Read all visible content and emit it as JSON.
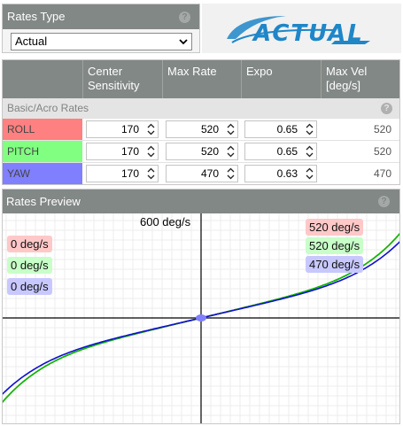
{
  "rates_type": {
    "title": "Rates Type",
    "help_glyph": "?",
    "selected": "Actual",
    "options": [
      "Actual"
    ]
  },
  "logo": {
    "text": "ACTUAL",
    "color": "#1f86c8"
  },
  "table": {
    "headers": [
      "",
      "Center Sensitivity",
      "Max Rate",
      "Expo",
      "Max Vel [deg/s]"
    ],
    "section_label": "Basic/Acro Rates",
    "help_glyph": "?",
    "rows": [
      {
        "axis": "ROLL",
        "color": "#ff8080",
        "center": "170",
        "max_rate": "520",
        "expo": "0.65",
        "max_vel": "520"
      },
      {
        "axis": "PITCH",
        "color": "#80ff80",
        "center": "170",
        "max_rate": "520",
        "expo": "0.65",
        "max_vel": "520"
      },
      {
        "axis": "YAW",
        "color": "#8080ff",
        "center": "170",
        "max_rate": "470",
        "expo": "0.63",
        "max_vel": "470"
      }
    ]
  },
  "preview": {
    "title": "Rates Preview",
    "help_glyph": "?",
    "max_label": "600 deg/s",
    "current_labels": [
      "0 deg/s",
      "0 deg/s",
      "0 deg/s"
    ],
    "max_labels": [
      "520 deg/s",
      "520 deg/s",
      "470 deg/s"
    ]
  },
  "chart_data": {
    "type": "line",
    "xlim": [
      -1,
      1
    ],
    "ylim": [
      -600,
      600
    ],
    "grid": true,
    "series": [
      {
        "name": "ROLL",
        "color": "#d03030",
        "center": 170,
        "max_rate": 520,
        "expo": 0.65
      },
      {
        "name": "PITCH",
        "color": "#00c000",
        "center": 170,
        "max_rate": 520,
        "expo": 0.65
      },
      {
        "name": "YAW",
        "color": "#1010d0",
        "center": 170,
        "max_rate": 470,
        "expo": 0.63
      }
    ]
  }
}
